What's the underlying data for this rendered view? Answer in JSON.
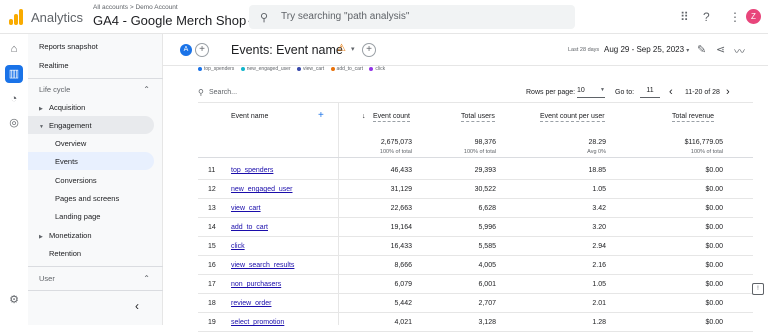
{
  "app": {
    "name": "Analytics",
    "breadcrumb": "All accounts > Demo Account",
    "property": "GA4 - Google Merch Shop"
  },
  "search": {
    "placeholder": "Try searching \"path analysis\""
  },
  "user": {
    "initial": "Z"
  },
  "colors": {
    "accent": "#1a73e8",
    "logo": "#f9ab00",
    "avatar": "#e8457b",
    "link": "#1a0dab",
    "selected_nav": "#e8f0fe"
  },
  "sidebar": {
    "top_items": [
      "Reports snapshot",
      "Realtime"
    ],
    "section_lifecycle": "Life cycle",
    "acquisition": "Acquisition",
    "engagement": "Engagement",
    "engagement_children": [
      "Overview",
      "Events",
      "Conversions",
      "Pages and screens",
      "Landing page"
    ],
    "monetization": "Monetization",
    "retention": "Retention",
    "section_user": "User",
    "collapse_icon": "chevron-left-icon"
  },
  "report": {
    "comparison_chip": "A",
    "title": "Events: Event name",
    "date_label": "Last 28 days",
    "date_range": "Aug 29 - Sep 25, 2023"
  },
  "table": {
    "search_placeholder": "Search...",
    "rows_per_page_label": "Rows per page:",
    "rows_per_page": "10",
    "goto_label": "Go to:",
    "goto_value": "11",
    "page_range": "11-20 of 28",
    "headers": {
      "dimension": "Event name",
      "event_count": "Event count",
      "total_users": "Total users",
      "event_count_per_user": "Event count per user",
      "total_revenue": "Total revenue"
    },
    "totals": {
      "event_count": "2,675,073",
      "event_count_sub": "100% of total",
      "total_users": "98,376",
      "total_users_sub": "100% of total",
      "event_count_per_user": "28.29",
      "event_count_per_user_sub": "Avg 0%",
      "total_revenue": "$116,779.05",
      "total_revenue_sub": "100% of total"
    },
    "rows": [
      {
        "idx": "11",
        "name": "top_spenders",
        "count": "46,433",
        "users": "29,393",
        "per_user": "18.85",
        "revenue": "$0.00"
      },
      {
        "idx": "12",
        "name": "new_engaged_user",
        "count": "31,129",
        "users": "30,522",
        "per_user": "1.05",
        "revenue": "$0.00"
      },
      {
        "idx": "13",
        "name": "view_cart",
        "count": "22,663",
        "users": "6,628",
        "per_user": "3.42",
        "revenue": "$0.00"
      },
      {
        "idx": "14",
        "name": "add_to_cart",
        "count": "19,164",
        "users": "5,996",
        "per_user": "3.20",
        "revenue": "$0.00"
      },
      {
        "idx": "15",
        "name": "click",
        "count": "16,433",
        "users": "5,585",
        "per_user": "2.94",
        "revenue": "$0.00"
      },
      {
        "idx": "16",
        "name": "view_search_results",
        "count": "8,666",
        "users": "4,005",
        "per_user": "2.16",
        "revenue": "$0.00"
      },
      {
        "idx": "17",
        "name": "non_purchasers",
        "count": "6,079",
        "users": "6,001",
        "per_user": "1.05",
        "revenue": "$0.00"
      },
      {
        "idx": "18",
        "name": "review_order",
        "count": "5,442",
        "users": "2,707",
        "per_user": "2.01",
        "revenue": "$0.00"
      },
      {
        "idx": "19",
        "name": "select_promotion",
        "count": "4,021",
        "users": "3,128",
        "per_user": "1.28",
        "revenue": "$0.00"
      }
    ]
  }
}
